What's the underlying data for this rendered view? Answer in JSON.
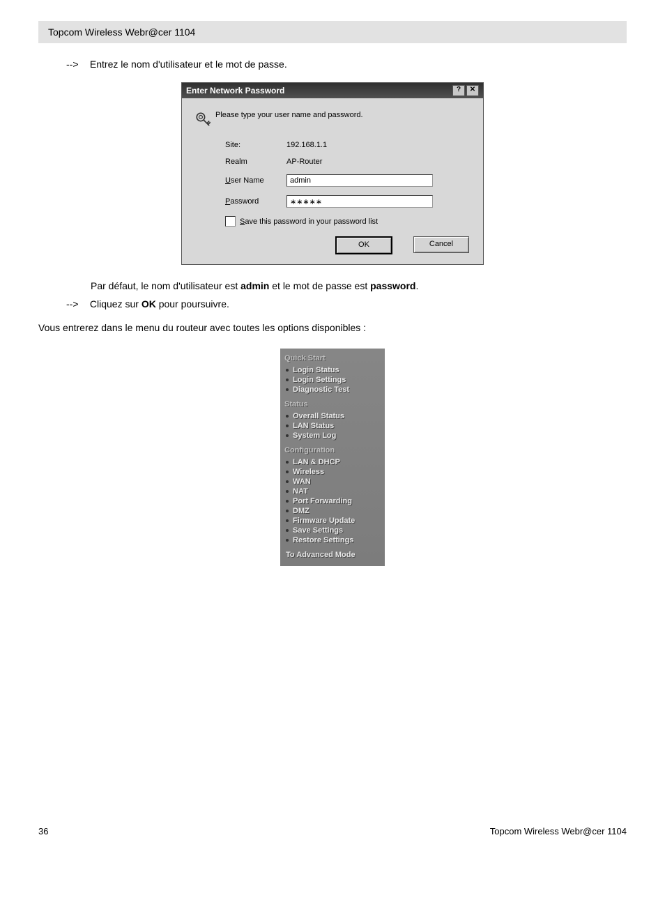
{
  "header": "Topcom Wireless Webr@cer 1104",
  "instr1": {
    "arrow": "-->",
    "text": "Entrez le nom d'utilisateur et le mot de passe."
  },
  "dialog": {
    "title": "Enter Network Password",
    "help": "?",
    "close": "✕",
    "prompt": "Please type your user name and password.",
    "site_label": "Site:",
    "site_value": "192.168.1.1",
    "realm_label": "Realm",
    "realm_value": "AP-Router",
    "user_label": "User Name",
    "user_value": "admin",
    "pass_label": "Password",
    "pass_value": "∗∗∗∗∗",
    "save_label": "Save this password in your password list",
    "ok": "OK",
    "cancel": "Cancel"
  },
  "defaults": {
    "pre": "Par défaut, le nom d'utilisateur est ",
    "admin": "admin",
    "mid": " et le mot de passe est ",
    "password": "password",
    "post": "."
  },
  "instr2": {
    "arrow": "-->",
    "pre": "Cliquez sur ",
    "ok": "OK",
    "post": " pour poursuivre."
  },
  "intro_menu": "Vous entrerez dans le menu du routeur avec toutes les options disponibles :",
  "menu": {
    "quick_start": {
      "heading": "Quick Start",
      "items": [
        "Login Status",
        "Login Settings",
        "Diagnostic Test"
      ]
    },
    "status": {
      "heading": "Status",
      "items": [
        "Overall Status",
        "LAN Status",
        "System Log"
      ]
    },
    "configuration": {
      "heading": "Configuration",
      "items": [
        "LAN & DHCP",
        "Wireless",
        "WAN",
        "NAT",
        "Port Forwarding",
        "DMZ",
        "Firmware Update",
        "Save Settings",
        "Restore Settings"
      ]
    },
    "advanced": "To Advanced Mode"
  },
  "footer": {
    "page": "36",
    "product": "Topcom Wireless Webr@cer 1104"
  }
}
